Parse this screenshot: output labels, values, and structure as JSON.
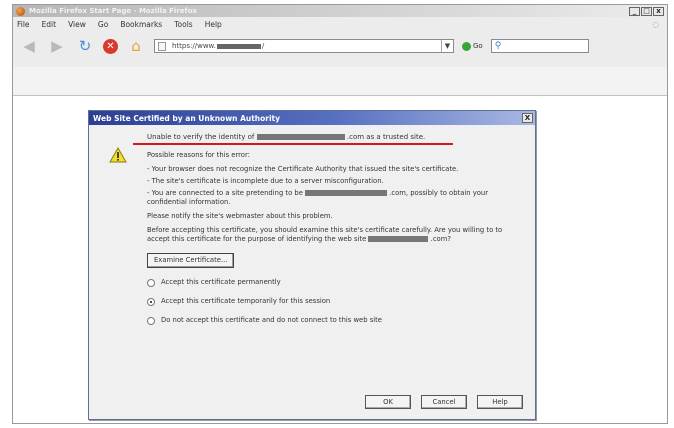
{
  "browser": {
    "window_title": "Mozilla Firefox Start Page - Mozilla Firefox",
    "menu": [
      "File",
      "Edit",
      "View",
      "Go",
      "Bookmarks",
      "Tools",
      "Help"
    ],
    "url_prefix": "https://www.",
    "url_suffix": "/",
    "go_label": "Go",
    "icons": {
      "back": "back-arrow-icon",
      "forward": "forward-arrow-icon",
      "reload": "reload-icon",
      "stop": "stop-icon",
      "home": "home-icon",
      "go": "go-icon",
      "search": "search-icon"
    }
  },
  "dialog": {
    "title": "Web Site Certified by an Unknown Authority",
    "close_label": "X",
    "headline_prefix": "Unable to verify the identity of",
    "headline_suffix": ".com as a trusted site.",
    "reasons_intro": "Possible reasons for this error:",
    "reasons": [
      "- Your browser does not recognize the Certificate Authority that issued the site's certificate.",
      "- The site's certificate is incomplete due to a server misconfiguration.",
      "- You are connected to a site pretending to be",
      ".com, possibly to obtain your confidential information."
    ],
    "notify": "Please notify the site's webmaster about this problem.",
    "before_accepting": "Before accepting this certificate, you should examine this site's certificate carefully. Are you willing to to accept this certificate for the purpose of identifying the web site",
    "before_suffix": ".com?",
    "examine_button": "Examine Certificate...",
    "options": [
      {
        "label": "Accept this certificate permanently",
        "checked": false
      },
      {
        "label": "Accept this certificate temporarily for this session",
        "checked": true
      },
      {
        "label": "Do not accept this certificate and do not connect to this web site",
        "checked": false
      }
    ],
    "buttons": {
      "ok": "OK",
      "cancel": "Cancel",
      "help": "Help"
    },
    "accent_color": "#d11b1b"
  }
}
